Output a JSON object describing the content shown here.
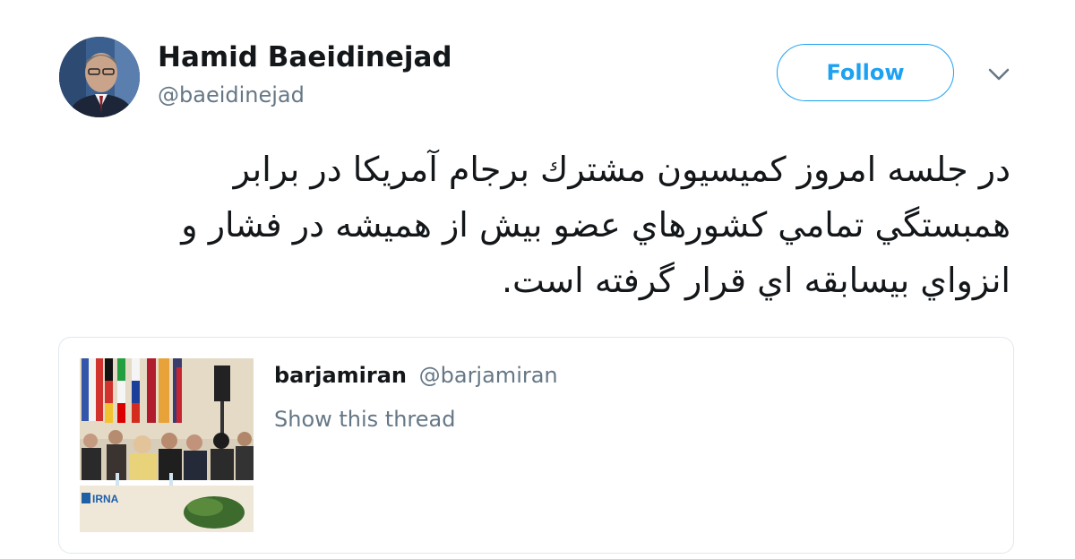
{
  "author": {
    "name": "Hamid Baeidinejad",
    "handle": "@baeidinejad",
    "avatar_icon": "profile-photo"
  },
  "follow_button": {
    "label": "Follow"
  },
  "menu": {
    "icon": "chevron-down-icon"
  },
  "tweet": {
    "text": "در جلسه امروز كميسيون مشترك برجام آمريكا در برابر همبستگي تمامي كشورهاي عضو بيش از هميشه در فشار و انزواي بيسابقه اي قرار گرفته است."
  },
  "quoted_tweet": {
    "name": "barjamiran",
    "handle": "@barjamiran",
    "show_thread": "Show this thread",
    "image_watermark": "IRNA"
  },
  "colors": {
    "accent": "#1da1f2",
    "text": "#14171a",
    "muted": "#657786",
    "border": "#e1e8ed"
  }
}
